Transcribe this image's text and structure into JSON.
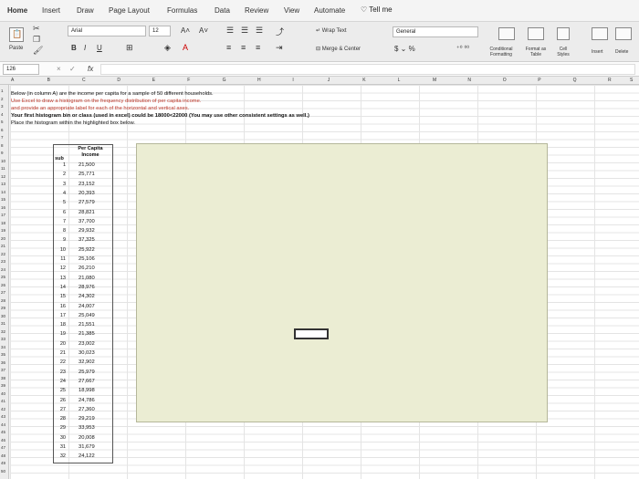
{
  "ribbon": {
    "tabs": [
      "Home",
      "Insert",
      "Draw",
      "Page Layout",
      "Formulas",
      "Data",
      "Review",
      "View",
      "Automate"
    ],
    "tell_me": "Tell me",
    "font_name": "Arial",
    "font_size": "12",
    "paste_label": "Paste",
    "wrap_text": "Wrap Text",
    "merge_center": "Merge & Center",
    "number_format": "General",
    "conditional_formatting": "Conditional Formatting",
    "format_as_table": "Format as Table",
    "cell_styles": "Cell Styles",
    "insert": "Insert",
    "delete": "Delete"
  },
  "formula_bar": {
    "name_box": "126",
    "fx": "fx",
    "cancel": "×",
    "confirm": "✓"
  },
  "columns": [
    "A",
    "B",
    "C",
    "D",
    "E",
    "F",
    "G",
    "H",
    "I",
    "J",
    "K",
    "L",
    "M",
    "N",
    "O",
    "P",
    "Q",
    "R",
    "S"
  ],
  "rows": [
    "1",
    "2",
    "3",
    "4",
    "5",
    "6",
    "7",
    "8",
    "9",
    "10",
    "11",
    "12",
    "13",
    "14",
    "15",
    "16",
    "17",
    "18",
    "19",
    "20",
    "21",
    "22",
    "23",
    "24",
    "25",
    "26",
    "27",
    "28",
    "29",
    "30",
    "31",
    "32",
    "33",
    "34",
    "35",
    "36",
    "37",
    "38",
    "39",
    "40",
    "41",
    "42",
    "43",
    "44",
    "45",
    "46",
    "47",
    "48",
    "49",
    "50"
  ],
  "instructions": [
    "Below (in column A) are the income per capita for a sample of 50 different households.",
    "Use Excel to draw a histogram on the frequency distribution of per capita income.",
    "and provide an appropriate label for each of the horizontal and vertical axes.",
    "Your first histogram bin or class (used in excel) could be 18000<22000 (You may use other consistent settings as well.)",
    "Place the histogram within the highlighted box below."
  ],
  "table": {
    "obs_header": "sub",
    "value_header": "Per Capita Income",
    "rows": [
      {
        "n": "1",
        "v": "21,500"
      },
      {
        "n": "2",
        "v": "25,771"
      },
      {
        "n": "3",
        "v": "23,152"
      },
      {
        "n": "4",
        "v": "20,393"
      },
      {
        "n": "5",
        "v": "27,579"
      },
      {
        "n": "6",
        "v": "28,821"
      },
      {
        "n": "7",
        "v": "37,700"
      },
      {
        "n": "8",
        "v": "29,932"
      },
      {
        "n": "9",
        "v": "37,325"
      },
      {
        "n": "10",
        "v": "25,922"
      },
      {
        "n": "11",
        "v": "25,106"
      },
      {
        "n": "12",
        "v": "26,210"
      },
      {
        "n": "13",
        "v": "21,080"
      },
      {
        "n": "14",
        "v": "28,976"
      },
      {
        "n": "15",
        "v": "24,302"
      },
      {
        "n": "16",
        "v": "24,007"
      },
      {
        "n": "17",
        "v": "25,049"
      },
      {
        "n": "18",
        "v": "21,551"
      },
      {
        "n": "19",
        "v": "21,385"
      },
      {
        "n": "20",
        "v": "23,002"
      },
      {
        "n": "21",
        "v": "30,023"
      },
      {
        "n": "22",
        "v": "32,902"
      },
      {
        "n": "23",
        "v": "25,979"
      },
      {
        "n": "24",
        "v": "27,667"
      },
      {
        "n": "25",
        "v": "18,998"
      },
      {
        "n": "26",
        "v": "24,786"
      },
      {
        "n": "27",
        "v": "27,360"
      },
      {
        "n": "28",
        "v": "29,219"
      },
      {
        "n": "29",
        "v": "33,953"
      },
      {
        "n": "30",
        "v": "20,008"
      },
      {
        "n": "31",
        "v": "31,679"
      },
      {
        "n": "32",
        "v": "24,122"
      }
    ]
  },
  "colors": {
    "highlight_box": "#ebedd3",
    "instruction_red": "#c0392b"
  }
}
